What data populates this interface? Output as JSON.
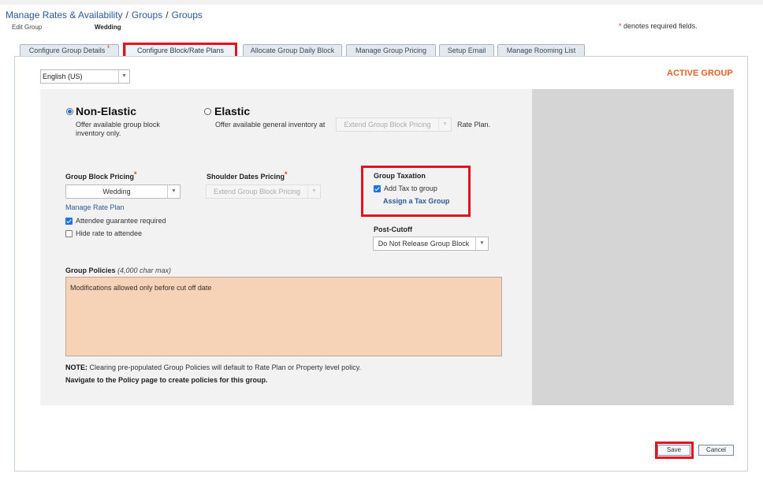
{
  "breadcrumb": {
    "items": [
      "Manage Rates & Availability",
      "Groups",
      "Groups"
    ],
    "separator": "/"
  },
  "header": {
    "edit_label": "Edit Group",
    "group_name": "Wedding",
    "required_star": "*",
    "required_note": "denotes required fields."
  },
  "tabs": [
    {
      "label": "Configure Group Details",
      "required": "*"
    },
    {
      "label": "Configure Block/Rate Plans"
    },
    {
      "label": "Allocate Group Daily Block"
    },
    {
      "label": "Manage Group Pricing"
    },
    {
      "label": "Setup Email"
    },
    {
      "label": "Manage Rooming List"
    }
  ],
  "language": {
    "selected": "English (US)"
  },
  "status": {
    "label": "ACTIVE GROUP",
    "color": "#e0642a"
  },
  "inventory": {
    "non_elastic": {
      "label": "Non-Elastic",
      "description": "Offer available group block inventory only.",
      "selected": true
    },
    "elastic": {
      "label": "Elastic",
      "description": "Offer available general inventory at",
      "select_value": "Extend Group Block Pricing",
      "suffix": "Rate Plan.",
      "selected": false
    }
  },
  "pricing": {
    "group_block_label": "Group Block Pricing",
    "group_block_value": "Wedding",
    "shoulder_label": "Shoulder Dates Pricing",
    "shoulder_value": "Extend Group Block Pricing",
    "required_star": "*",
    "manage_rate_plan": "Manage Rate Plan",
    "attendee_guarantee": "Attendee guarantee required",
    "hide_rate": "Hide rate to attendee"
  },
  "taxation": {
    "title": "Group Taxation",
    "add_tax_label": "Add Tax to group",
    "assign_link": "Assign a Tax Group"
  },
  "post_cutoff": {
    "label": "Post-Cutoff",
    "value": "Do Not Release Group Block"
  },
  "policies": {
    "label": "Group Policies",
    "limit": "(4,000 char max)",
    "text": "Modifications allowed only before cut off date",
    "note_prefix": "NOTE:",
    "note": "Clearing pre-populated Group Policies will default to Rate Plan or Property level policy.",
    "navigate_note": "Navigate to the Policy page to create policies for this group."
  },
  "actions": {
    "save": "Save",
    "cancel": "Cancel"
  },
  "colors": {
    "accent_link": "#1a73b0",
    "highlight": "#e0141e",
    "policy_bg": "#f6d3b6"
  },
  "icons": {
    "dropdown": "chevron-down-icon",
    "radio": "radio-icon",
    "checkbox": "check-icon"
  }
}
